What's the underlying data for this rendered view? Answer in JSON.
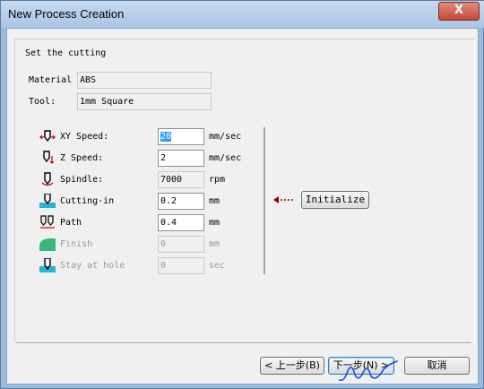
{
  "window": {
    "title": "New Process Creation",
    "close_glyph": "X"
  },
  "section": {
    "title": "Set the cutting"
  },
  "info": [
    {
      "label": "Material",
      "value": "ABS"
    },
    {
      "label": "Tool:",
      "value": "1mm Square"
    }
  ],
  "params": [
    {
      "label": "XY Speed:",
      "value": "20",
      "unit": "mm/sec",
      "enabled": true,
      "selected": true,
      "icon": "xy-speed-icon"
    },
    {
      "label": "Z Speed:",
      "value": "2",
      "unit": "mm/sec",
      "enabled": true,
      "icon": "z-speed-icon"
    },
    {
      "label": "Spindle:",
      "value": "7000",
      "unit": "rpm",
      "enabled": true,
      "icon": "spindle-icon"
    },
    {
      "label": "Cutting-in",
      "value": "0.2",
      "unit": "mm",
      "enabled": true,
      "icon": "cutting-in-icon"
    },
    {
      "label": "Path",
      "value": "0.4",
      "unit": "mm",
      "enabled": true,
      "icon": "path-icon"
    },
    {
      "label": "Finish",
      "value": "0",
      "unit": "mm",
      "enabled": false,
      "icon": "finish-icon"
    },
    {
      "label": "Stay at hole",
      "value": "0",
      "unit": "sec",
      "enabled": false,
      "icon": "stay-at-hole-icon"
    }
  ],
  "initialize": {
    "arrow_icon": "arrow-left-icon",
    "label": "Initialize"
  },
  "footer": {
    "back_label": "< 上一步(B)",
    "next_label": "下一步(N) >",
    "cancel_label": "取消"
  },
  "colors": {
    "title_bg": "#aac5e3",
    "close_bg": "#c6483a",
    "arrow": "#8b0000",
    "signature": "#1a4fd6"
  }
}
